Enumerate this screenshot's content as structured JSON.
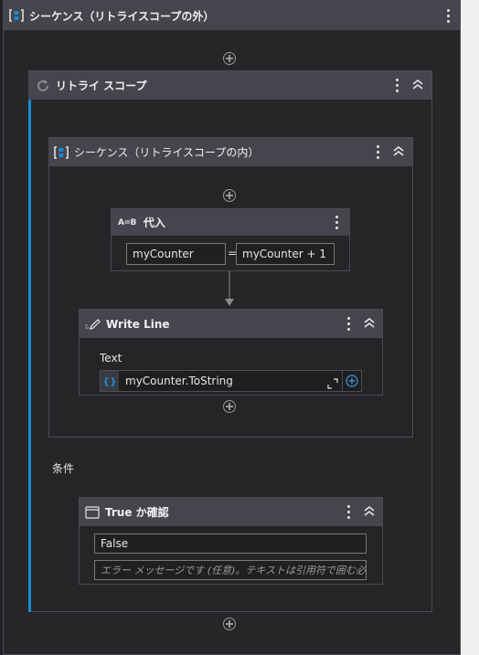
{
  "outer_sequence": {
    "title": "シーケンス（リトライスコープの外）"
  },
  "retry_scope": {
    "title": "リトライ スコープ",
    "condition_label": "条件"
  },
  "inner_sequence": {
    "title": "シーケンス（リトライスコープの内）"
  },
  "assign": {
    "title": "代入",
    "to_value": "myCounter",
    "equals": "=",
    "value": "myCounter + 1",
    "icon_text": "A=B"
  },
  "write_line": {
    "title": "Write Line",
    "text_label": "Text",
    "text_value": "myCounter.ToString",
    "expr_icon_text": "{}"
  },
  "check_true": {
    "title": "True か確認",
    "expression_value": "False",
    "error_placeholder": "エラー メッセージです (任意)。テキストは引用符で囲む必要があります。"
  },
  "colors": {
    "accent": "#1a8ad4",
    "header": "#45464d",
    "background": "#202023"
  }
}
